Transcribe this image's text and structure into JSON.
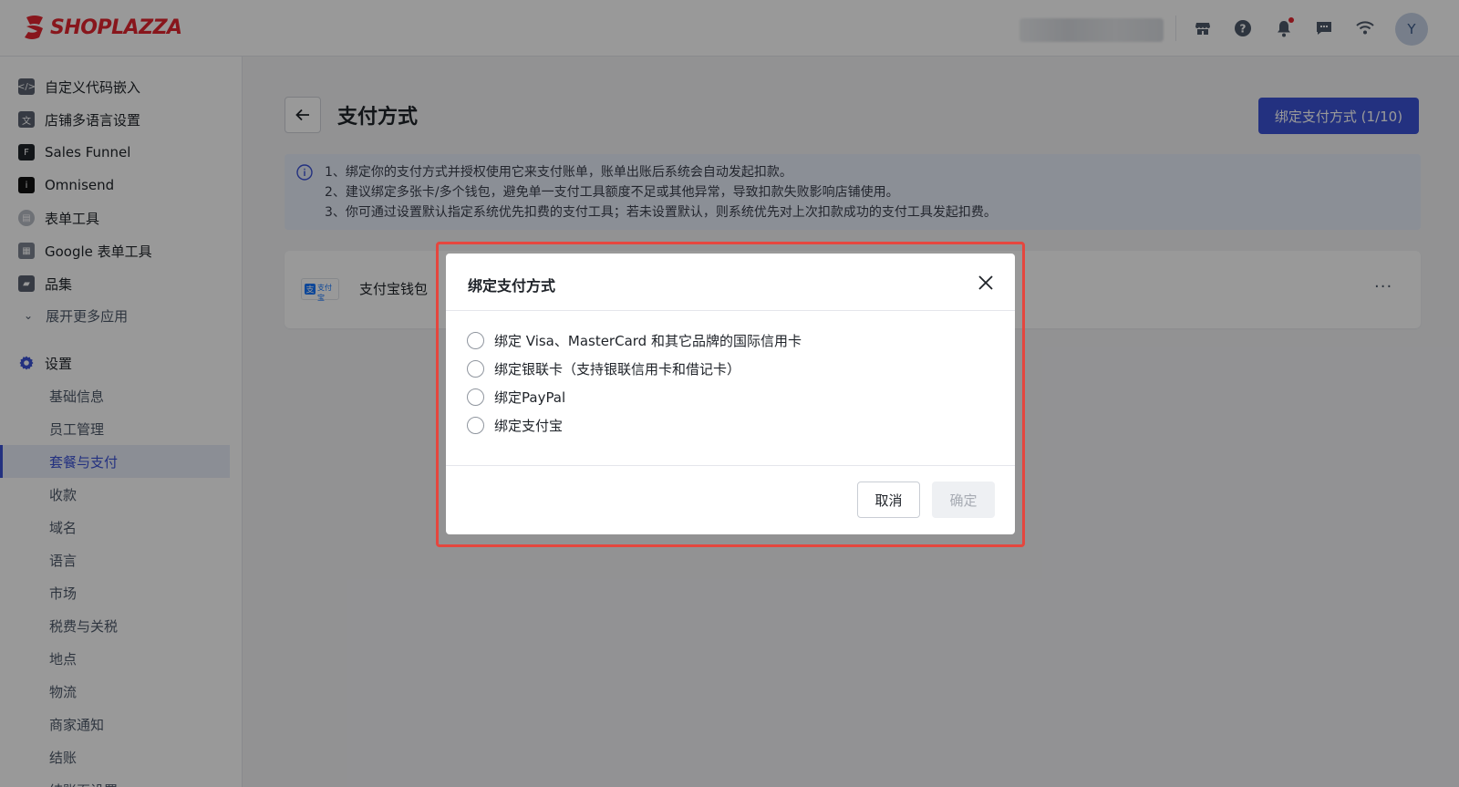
{
  "header": {
    "brand": "SHOPLAZZA",
    "avatar_initial": "Y",
    "icons": [
      "store-icon",
      "help-icon",
      "bell-icon",
      "chat-icon",
      "wifi-icon"
    ]
  },
  "sidebar": {
    "apps": [
      {
        "label": "自定义代码嵌入",
        "icon": "code-embed-icon"
      },
      {
        "label": "店铺多语言设置",
        "icon": "translate-icon"
      },
      {
        "label": "Sales Funnel",
        "icon": "funnel-icon"
      },
      {
        "label": "Omnisend",
        "icon": "omnisend-icon"
      },
      {
        "label": "表单工具",
        "icon": "form-icon"
      },
      {
        "label": "Google 表单工具",
        "icon": "google-form-icon"
      },
      {
        "label": "品集",
        "icon": "collection-icon"
      }
    ],
    "expand_label": "展开更多应用",
    "settings_label": "设置",
    "settings_items": [
      "基础信息",
      "员工管理",
      "套餐与支付",
      "收款",
      "域名",
      "语言",
      "市场",
      "税费与关税",
      "地点",
      "物流",
      "商家通知",
      "结账",
      "结账页设置"
    ],
    "active_item": "套餐与支付"
  },
  "main": {
    "title": "支付方式",
    "bind_button": "绑定支付方式 (1/10)",
    "notice": [
      "1、绑定你的支付方式并授权使用它来支付账单，账单出账后系统会自动发起扣款。",
      "2、建议绑定多张卡/多个钱包，避免单一支付工具额度不足或其他异常，导致扣款失败影响店铺使用。",
      "3、你可通过设置默认指定系统优先扣费的支付工具；若未设置默认，则系统优先对上次扣款成功的支付工具发起扣费。"
    ],
    "payment_method": {
      "logo_text": "支付宝",
      "name": "支付宝钱包",
      "more": "···"
    }
  },
  "modal": {
    "title": "绑定支付方式",
    "options": [
      "绑定 Visa、MasterCard 和其它品牌的国际信用卡",
      "绑定银联卡（支持银联信用卡和借记卡）",
      "绑定PayPal",
      "绑定支付宝"
    ],
    "cancel": "取消",
    "confirm": "确定"
  },
  "colors": {
    "primary": "#3b52d6",
    "brand_red": "#e3262f",
    "highlight": "#e5463e",
    "notice_bg": "#e8eefb"
  }
}
